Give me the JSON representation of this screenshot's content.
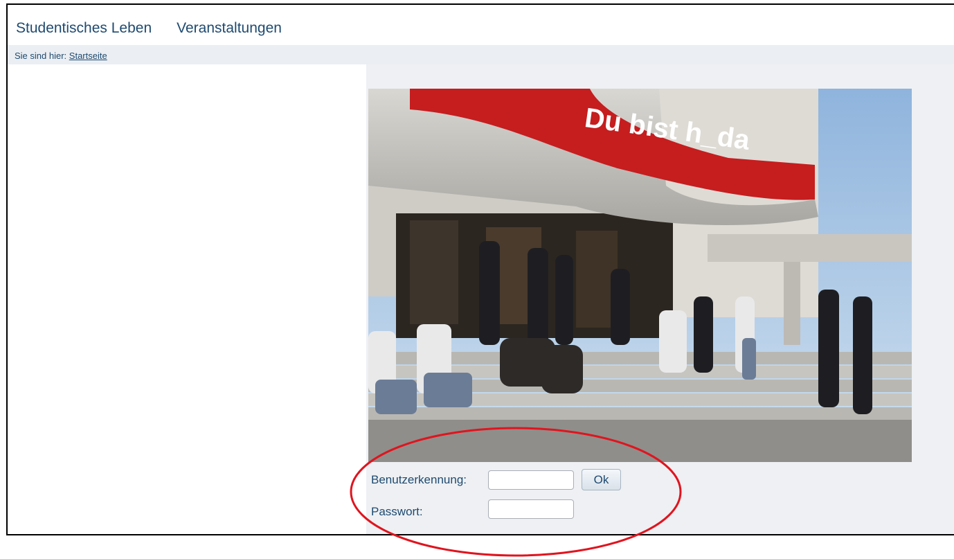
{
  "nav": {
    "items": [
      "Studentisches Leben",
      "Veranstaltungen"
    ]
  },
  "breadcrumb": {
    "prefix": "Sie sind hier:",
    "link": "Startseite"
  },
  "hero": {
    "banner_text": "Du bist h_da"
  },
  "login": {
    "username_label": "Benutzerkennung:",
    "password_label": "Passwort:",
    "username_value": "",
    "password_value": "",
    "ok_label": "Ok"
  },
  "annotation": {
    "circle_color": "#e0141e"
  }
}
